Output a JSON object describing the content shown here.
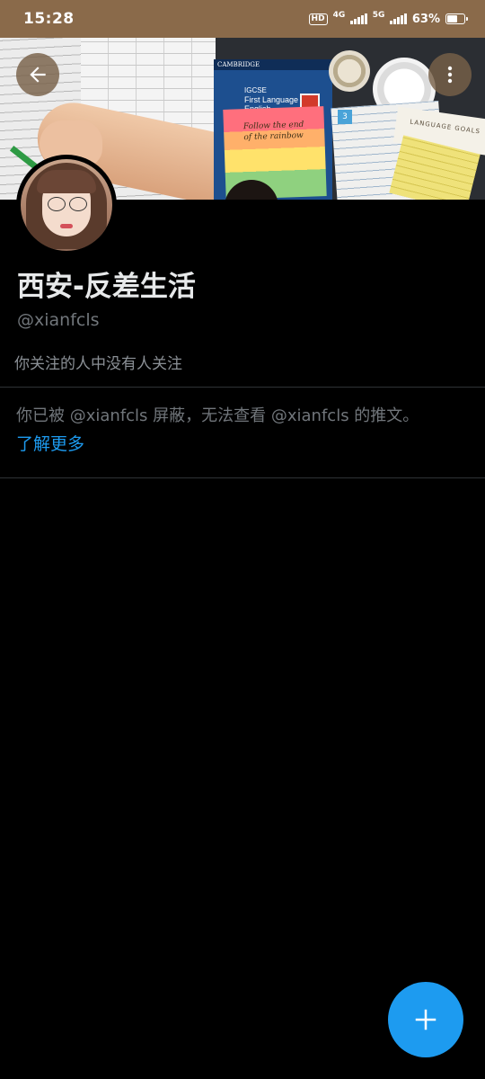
{
  "status_bar": {
    "time": "15:28",
    "hd_badge": "HD",
    "network_4g": "4G",
    "network_5g": "5G",
    "battery_percent": "63%",
    "battery_level": 0.63
  },
  "banner": {
    "book_publisher": "CAMBRIDGE",
    "book_title_small": "IGCSE",
    "book_title_line1": "First Language",
    "book_title_line2": "English",
    "sticky_line1": "Follow the end",
    "sticky_line2": "of the rainbow",
    "goals_card": "LANGUAGE GOALS",
    "white_book_tab": "3"
  },
  "header": {
    "back_icon": "arrow-left-icon",
    "more_icon": "more-vertical-icon"
  },
  "profile": {
    "display_name": "西安-反差生活",
    "handle": "@xianfcls",
    "follow_note": "你关注的人中没有人关注",
    "blocked_message": "你已被 @xianfcls 屏蔽，无法查看 @xianfcls 的推文。",
    "learn_more": "了解更多"
  },
  "fab": {
    "icon": "plus-icon",
    "color": "#1d9bf0"
  },
  "colors": {
    "background": "#000000",
    "accent": "#1d9bf0",
    "text_primary": "#e7e9ea",
    "text_secondary": "#71767b"
  }
}
